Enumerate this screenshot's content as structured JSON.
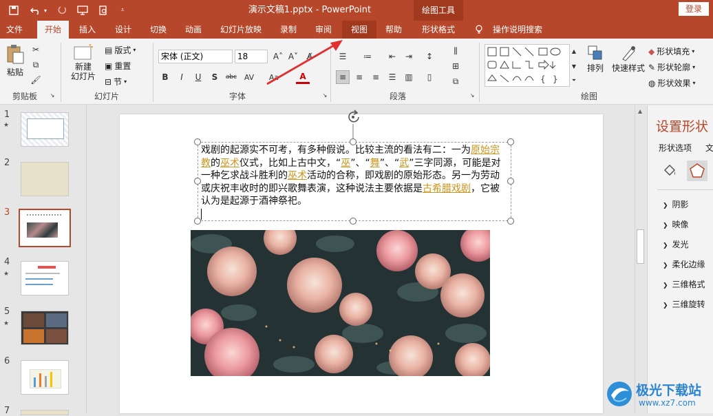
{
  "titlebar": {
    "title": "演示文稿1.pptx  -  PowerPoint",
    "drawing_tools": "绘图工具",
    "login": "登录"
  },
  "tabs": [
    "文件",
    "开始",
    "插入",
    "设计",
    "切换",
    "动画",
    "幻灯片放映",
    "录制",
    "审阅",
    "视图",
    "帮助",
    "形状格式",
    "操作说明搜索"
  ],
  "ribbon": {
    "clipboard": {
      "paste": "粘贴",
      "label": "剪贴板"
    },
    "slides": {
      "new_slide": "新建\n幻灯片",
      "layout": "版式",
      "reset": "重置",
      "section": "节",
      "label": "幻灯片"
    },
    "font": {
      "font_name": "宋体 (正文)",
      "font_size": "18",
      "label": "字体"
    },
    "paragraph": {
      "label": "段落"
    },
    "drawing": {
      "arrange": "排列",
      "quick_styles": "快速样式",
      "shape_fill": "形状填充",
      "shape_outline": "形状轮廓",
      "shape_effects": "形状效果",
      "label": "绘图"
    }
  },
  "slides": [
    {
      "num": "1",
      "star": true
    },
    {
      "num": "2",
      "star": false
    },
    {
      "num": "3",
      "star": false
    },
    {
      "num": "4",
      "star": true
    },
    {
      "num": "5",
      "star": true
    },
    {
      "num": "6",
      "star": false
    },
    {
      "num": "7",
      "star": false
    }
  ],
  "textbox": {
    "p1": "戏剧的起源实不可考，有多种假说。比较主流的看法有二：一为",
    "l1": "原始宗教",
    "p2": "的",
    "l2": "巫术",
    "p3": "仪式，比如上古中文，“",
    "l3": "巫",
    "p4": "”、“",
    "l4": "舞",
    "p5": "”、“",
    "l5": "武",
    "p6": "”三字同源，可能是对一种乞求战斗胜利的",
    "l6": "巫术",
    "p7": "活动的合称，即戏剧的原始形态。另一为劳动或庆祝丰收时的即兴歌舞表演，这种说法主要依据是",
    "l7": "古希腊戏剧",
    "p8": "，它被认为是起源于酒神祭祀。"
  },
  "pane": {
    "title": "设置形状",
    "tab1": "形状选项",
    "tab2": "文",
    "items": [
      "阴影",
      "映像",
      "发光",
      "柔化边缘",
      "三维格式",
      "三维旋转"
    ]
  },
  "watermark": {
    "text": "极光下载站",
    "url": "www.xz7.com"
  }
}
